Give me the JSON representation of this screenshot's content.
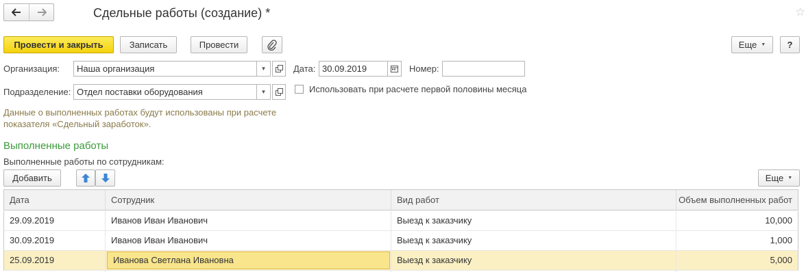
{
  "window": {
    "title": "Сдельные работы (создание) *"
  },
  "nav": {
    "back_icon": "arrow-left-icon",
    "forward_icon": "arrow-right-icon"
  },
  "toolbar": {
    "post_close_label": "Провести и закрыть",
    "save_label": "Записать",
    "post_label": "Провести",
    "more_label": "Еще",
    "help_label": "?"
  },
  "form": {
    "org_label": "Организация:",
    "org_value": "Наша организация",
    "date_label": "Дата:",
    "date_value": "30.09.2019",
    "number_label": "Номер:",
    "number_value": "",
    "dept_label": "Подразделение:",
    "dept_value": "Отдел поставки оборудования",
    "first_half_label": "Использовать при расчете первой половины месяца",
    "first_half_checked": false,
    "info_line1": "Данные о выполненных работах будут использованы при расчете",
    "info_line2": "показателя «Сдельный заработок»."
  },
  "section": {
    "title": "Выполненные работы",
    "subtitle": "Выполненные работы по сотрудникам:",
    "add_label": "Добавить",
    "more_label": "Еще"
  },
  "table": {
    "columns": [
      "Дата",
      "Сотрудник",
      "Вид работ",
      "Объем выполненных работ"
    ],
    "rows": [
      {
        "date": "29.09.2019",
        "employee": "Иванов Иван Иванович",
        "work": "Выезд к заказчику",
        "volume": "10,000"
      },
      {
        "date": "30.09.2019",
        "employee": "Иванов Иван Иванович",
        "work": "Выезд к заказчику",
        "volume": "1,000"
      },
      {
        "date": "25.09.2019",
        "employee": "Иванова Светлана Ивановна",
        "work": "Выезд к заказчику",
        "volume": "5,000"
      }
    ],
    "selected_row": 2
  },
  "colors": {
    "primary_button": "#f4d20e",
    "section_title": "#3a9a3a",
    "info_text": "#8a7a4a",
    "selected_row": "#fbf0c4",
    "selected_cell": "#f8e58c",
    "arrow_blue": "#3d86d6"
  }
}
